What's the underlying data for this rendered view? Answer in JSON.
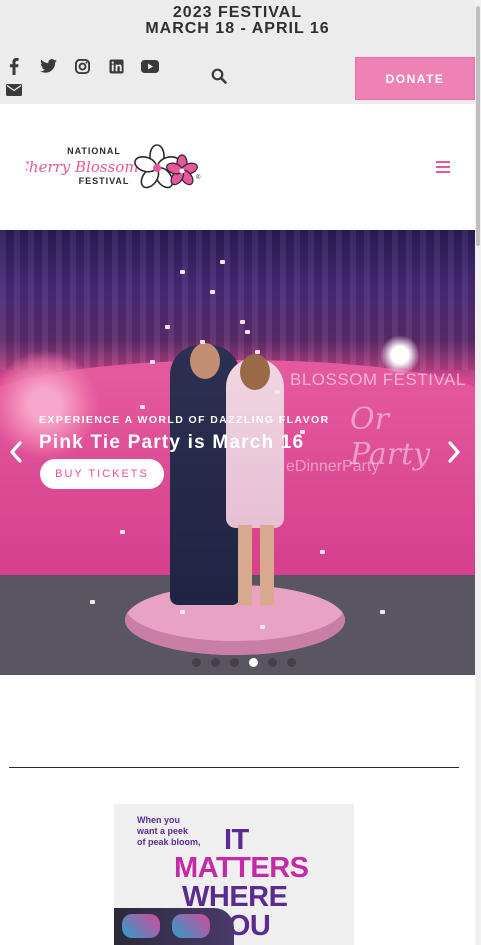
{
  "topbar": {
    "festival_year": "2023 FESTIVAL",
    "festival_dates": "MARCH 18 - APRIL 16",
    "social_icons": [
      "facebook-icon",
      "twitter-icon",
      "instagram-icon",
      "linkedin-icon",
      "youtube-icon",
      "envelope-icon"
    ],
    "search_icon": "search-icon",
    "donate_label": "DONATE"
  },
  "header": {
    "logo_line1": "NATIONAL",
    "logo_line2": "Cherry Blossom",
    "logo_line3": "FESTIVAL",
    "logo_mark": "®",
    "menu_icon": "hamburger-menu-icon"
  },
  "hero": {
    "wall_text_1": "BLOSSOM FESTIVAL",
    "wall_text_2": "Or Party",
    "wall_text_3": "eDinnerParty",
    "eyebrow": "EXPERIENCE A WORLD OF DAZZLING FLAVOR",
    "title": "Pink Tie Party is March 16",
    "cta_label": "BUY TICKETS",
    "prev_icon": "chevron-left-icon",
    "next_icon": "chevron-right-icon",
    "slide_count": 6,
    "active_slide": 4
  },
  "ad": {
    "small_text_1": "When you",
    "small_text_2": "want a peek",
    "small_text_3": "of peak bloom,",
    "big_text_1": "IT",
    "big_text_2": "MATTERS",
    "big_text_3": "WHERE",
    "big_text_4": "YOU"
  },
  "colors": {
    "accent_pink": "#ee82b5",
    "cta_text": "#ec4d9c",
    "ad_purple": "#5b2c90",
    "ad_magenta": "#c42aa7",
    "topbar_bg": "#ececec"
  }
}
